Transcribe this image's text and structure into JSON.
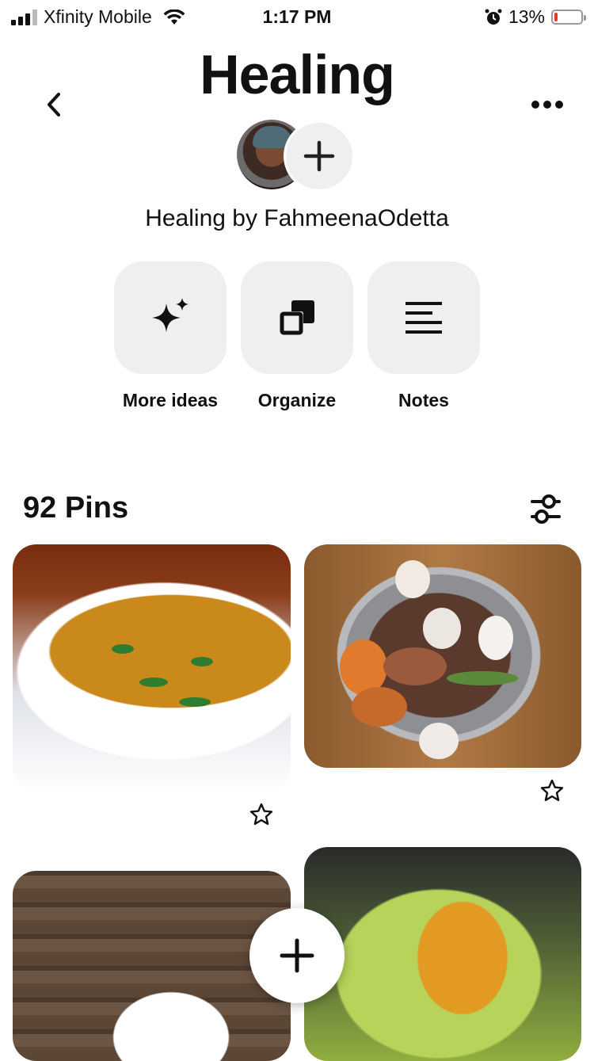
{
  "status_bar": {
    "carrier": "Xfinity Mobile",
    "time": "1:17 PM",
    "battery_percent": "13%",
    "battery_level": 0.13,
    "battery_color": "#e8392b",
    "icons": [
      "signal-icon",
      "wifi-icon",
      "alarm-icon",
      "battery-icon"
    ]
  },
  "header": {
    "title": "Healing",
    "back_icon": "chevron-left-icon",
    "more_icon": "ellipsis-icon"
  },
  "board": {
    "byline": "Healing by FahmeenaOdetta",
    "add_collaborator_icon": "plus-icon"
  },
  "actions": [
    {
      "label": "More ideas",
      "icon": "sparkle-icon"
    },
    {
      "label": "Organize",
      "icon": "organize-icon"
    },
    {
      "label": "Notes",
      "icon": "notes-icon"
    }
  ],
  "pins_section": {
    "count_label": "92 Pins",
    "filter_icon": "filter-sliders-icon"
  },
  "pins": [
    {
      "subject": "lentil soup",
      "save_icon": "star-icon"
    },
    {
      "subject": "vegetables in pot",
      "save_icon": "star-icon"
    },
    {
      "subject": "soup on wooden table"
    },
    {
      "subject": "greens with sauce"
    }
  ],
  "fab": {
    "icon": "plus-icon"
  },
  "colors": {
    "tile_bg": "#efefef",
    "text": "#111111",
    "background": "#ffffff"
  }
}
